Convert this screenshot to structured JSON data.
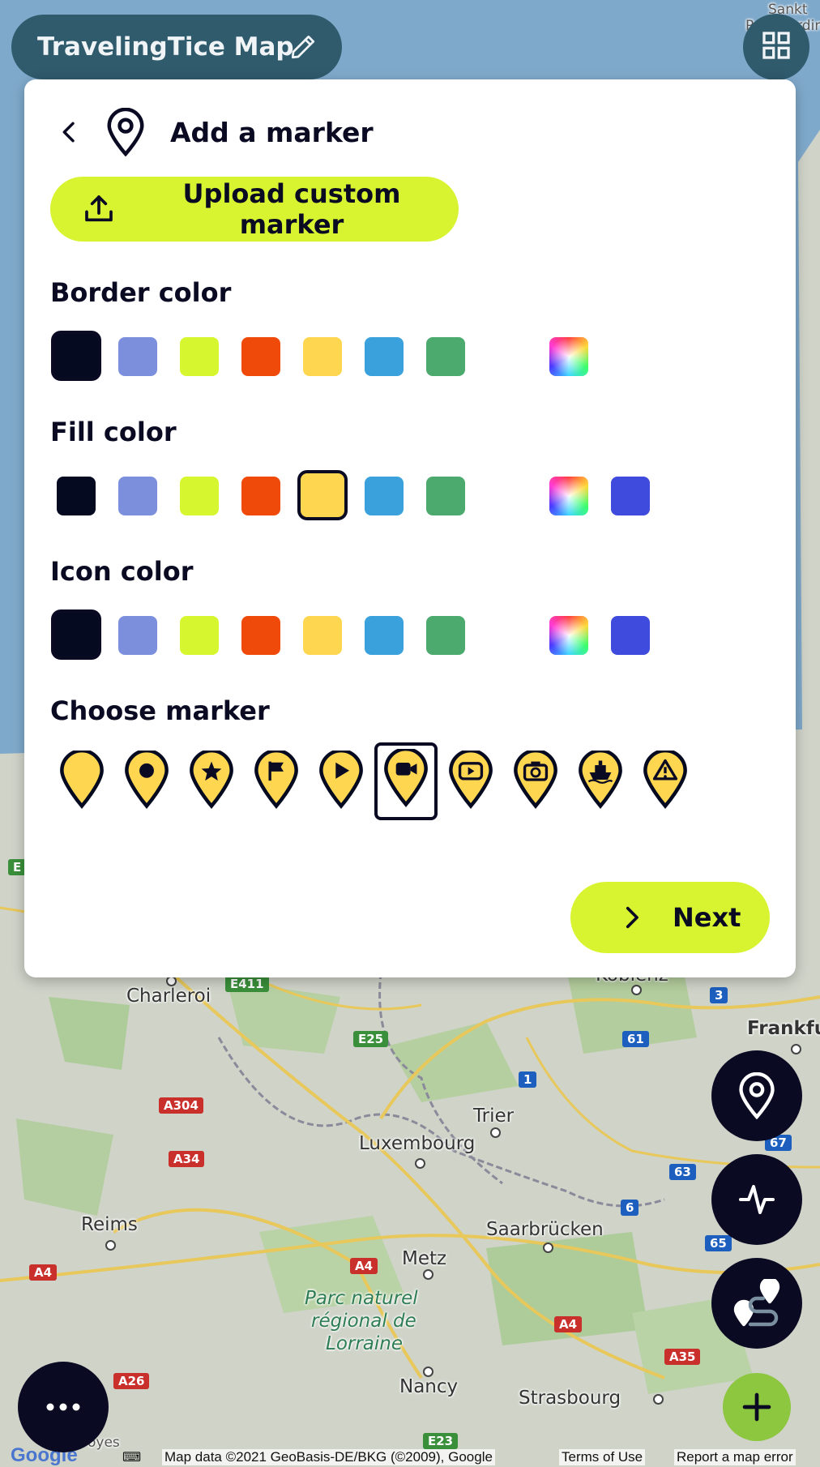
{
  "app": {
    "title": "TravelingTice Map"
  },
  "map": {
    "labels": {
      "sankt_line1": "Sankt",
      "sankt_line2": "Peter-Ordin",
      "charleroi": "Charleroi",
      "koblenz": "Koblenz",
      "frankfurt": "Frankfu",
      "trier": "Trier",
      "luxembourg": "Luxembourg",
      "reims": "Reims",
      "saarbrucken": "Saarbrücken",
      "metz": "Metz",
      "park_line1": "Parc naturel",
      "park_line2": "régional de",
      "park_line3": "Lorraine",
      "nancy": "Nancy",
      "strasbourg": "Strasbourg",
      "troyes": "oyes"
    },
    "shields": {
      "e411": "E411",
      "e25": "E25",
      "a304": "A304",
      "a34": "A34",
      "a4_left": "A4",
      "a4_mid": "A4",
      "a4_right": "A4",
      "a26": "A26",
      "e23": "E23",
      "a35": "A35",
      "n1": "1",
      "n3": "3",
      "n61": "61",
      "n63": "63",
      "n67": "67",
      "n6": "6",
      "n65": "65",
      "e_left": "E"
    },
    "footer": {
      "google": "Google",
      "map_data": "Map data ©2021 GeoBasis-DE/BKG (©2009), Google",
      "terms": "Terms of Use",
      "report": "Report a map error"
    }
  },
  "panel": {
    "title": "Add a marker",
    "upload_label": "Upload custom marker",
    "border_color_title": "Border color",
    "fill_color_title": "Fill color",
    "icon_color_title": "Icon color",
    "choose_marker_title": "Choose marker",
    "next_label": "Next",
    "palette": [
      "#050a20",
      "#7b8fdd",
      "#d6f72f",
      "#f04a0b",
      "#ffd650",
      "#3aa1dd",
      "#4caa6e"
    ],
    "custom_color": "#3f4bdd",
    "border_selected": "#050a20",
    "fill_selected": "#ffd650",
    "icon_selected": "#050a20",
    "markers": [
      "plain",
      "dot",
      "star",
      "flag",
      "play",
      "video-camera",
      "youtube",
      "camera",
      "ship",
      "warning"
    ],
    "marker_selected": "video-camera"
  },
  "icons": {
    "edit": "pencil-icon",
    "grid": "grid-icon",
    "back": "chevron-left-icon",
    "pin": "map-pin-icon",
    "upload": "upload-icon",
    "next": "chevron-right-icon",
    "location": "location-pin-icon",
    "activity": "activity-icon",
    "route": "route-icon",
    "more": "more-dots-icon",
    "add": "plus-icon"
  }
}
